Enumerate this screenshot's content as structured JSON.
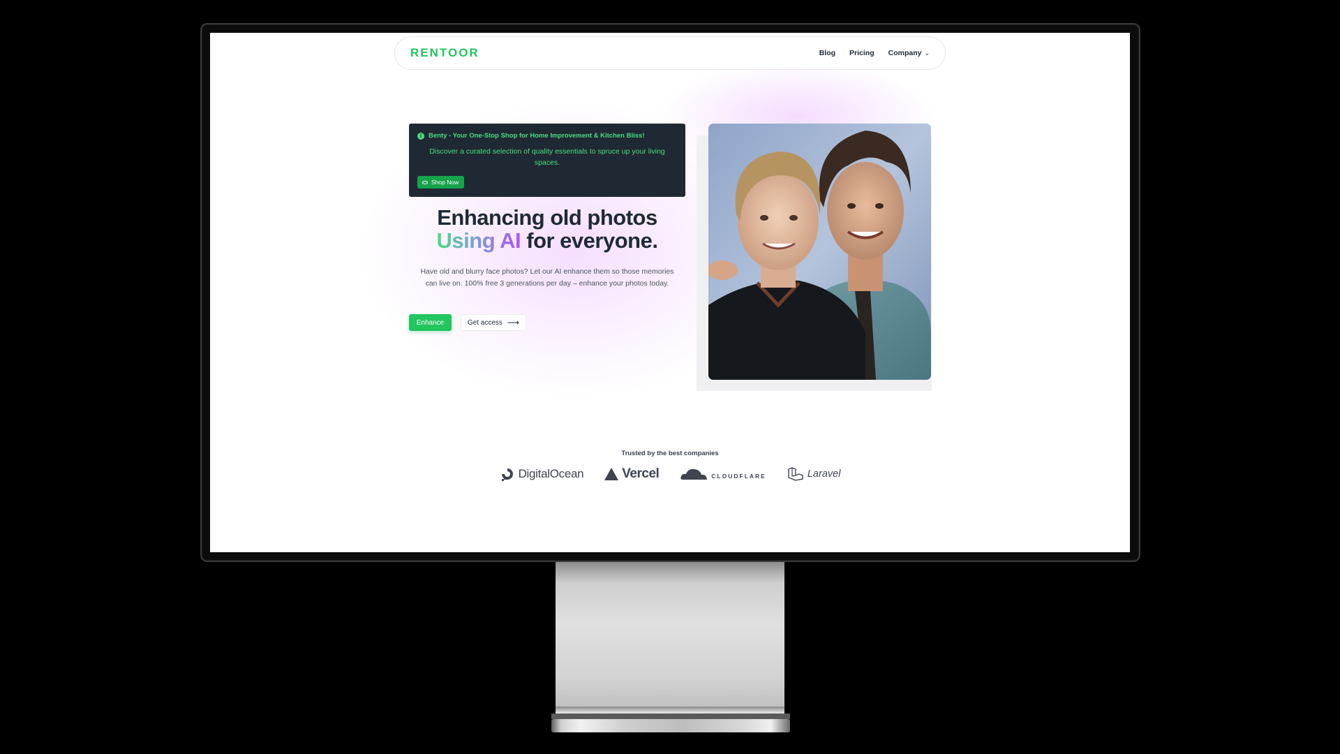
{
  "nav": {
    "brand": "RENTOOR",
    "links": [
      "Blog",
      "Pricing",
      "Company"
    ]
  },
  "banner": {
    "title": "Benty - Your One-Stop Shop for Home Improvement & Kitchen Bliss!",
    "description": "Discover a curated selection of quality essentials to spruce up your living spaces.",
    "button": "Shop Now"
  },
  "hero": {
    "headline_line1": "Enhancing old photos",
    "headline_gradient": "Using AI",
    "headline_rest": "for everyone.",
    "subtext": "Have old and blurry face photos? Let our AI enhance them so those memories can live on. 100% free 3 generations per day – enhance your photos today.",
    "primary_button": "Enhance",
    "secondary_button": "Get access"
  },
  "trusted": {
    "heading": "Trusted by the best companies",
    "logos": [
      "DigitalOcean",
      "Vercel",
      "CLOUDFLARE",
      "Laravel"
    ]
  },
  "colors": {
    "brand_green": "#22c55e",
    "banner_bg": "#1f2933",
    "headline": "#1f2937"
  },
  "icons": [
    "info-icon",
    "eye-icon",
    "chevron-down-icon",
    "arrow-right-icon"
  ]
}
